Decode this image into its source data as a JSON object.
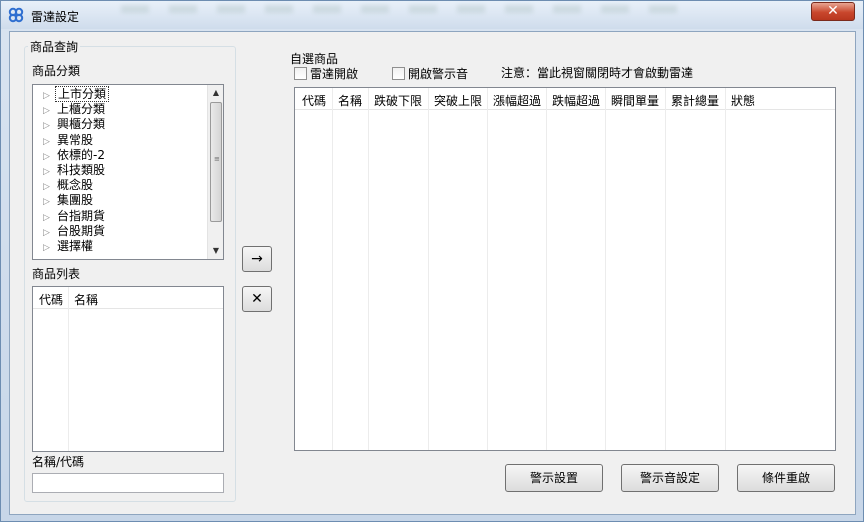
{
  "window": {
    "title": "雷達設定",
    "close_label": "✕"
  },
  "query_group": {
    "title": "商品查詢",
    "category_label": "商品分類",
    "categories": [
      "上市分類",
      "上櫃分類",
      "興櫃分類",
      "異常股",
      "依標的-2",
      "科技類股",
      "概念股",
      "集團股",
      "台指期貨",
      "台股期貨",
      "選擇權"
    ],
    "list_label": "商品列表",
    "list_columns": [
      "代碼",
      "名稱"
    ],
    "search_label": "名稱/代碼",
    "search_value": ""
  },
  "transfer": {
    "add_label": "→",
    "remove_label": "✕"
  },
  "watch_group": {
    "title": "自選商品",
    "radar_enable_label": "雷達開啟",
    "sound_enable_label": "開啟警示音",
    "notice": "注意：當此視窗關閉時才會啟動雷達",
    "columns": [
      "代碼",
      "名稱",
      "跌破下限",
      "突破上限",
      "漲幅超過",
      "跌幅超過",
      "瞬間單量",
      "累計總量",
      "狀態"
    ]
  },
  "buttons": {
    "alert_settings": "警示設置",
    "sound_settings": "警示音設定",
    "reset_conditions": "條件重啟"
  }
}
